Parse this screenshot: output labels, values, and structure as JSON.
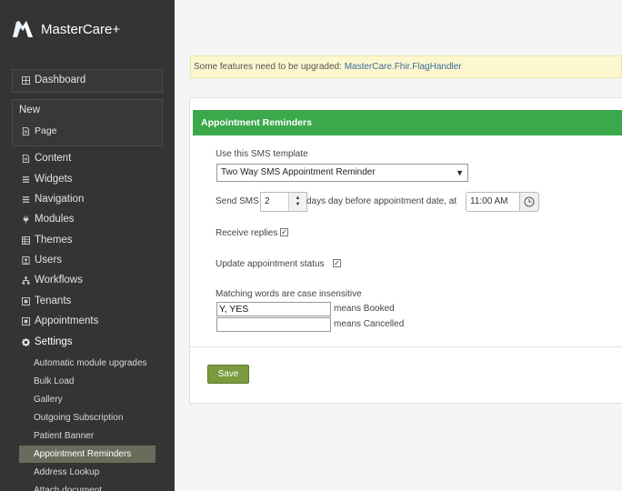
{
  "app": {
    "brand": "MasterCare+"
  },
  "sidebar": {
    "dashboard": "Dashboard",
    "new_title": "New",
    "new_page": "Page",
    "items": [
      {
        "label": "Content",
        "icon": "list-icon"
      },
      {
        "label": "Widgets",
        "icon": "list-icon"
      },
      {
        "label": "Navigation",
        "icon": "list-icon"
      },
      {
        "label": "Modules",
        "icon": "plug-icon"
      },
      {
        "label": "Themes",
        "icon": "grid-icon"
      },
      {
        "label": "Users",
        "icon": "user-icon"
      },
      {
        "label": "Workflows",
        "icon": "sitemap-icon"
      },
      {
        "label": "Tenants",
        "icon": "square-icon"
      },
      {
        "label": "Appointments",
        "icon": "square-icon"
      },
      {
        "label": "Settings",
        "icon": "gear-icon"
      }
    ],
    "settings_sub": [
      "Automatic module upgrades",
      "Bulk Load",
      "Gallery",
      "Outgoing Subscription",
      "Patient Banner",
      "Appointment Reminders",
      "Address Lookup",
      "Attach document"
    ],
    "active_sub": "Appointment Reminders"
  },
  "warning": {
    "text": "Some features need to be upgraded: ",
    "link": "MasterCare.Fhir.FlagHandler"
  },
  "panel": {
    "title": "Appointment Reminders",
    "template_label": "Use this SMS template",
    "template_value": "Two Way SMS Appointment Reminder",
    "send_sms_label": "Send SMS",
    "days_value": "2",
    "days_suffix": "days day before appointment date, at",
    "time_value": "11:00 AM",
    "receive_replies_label": "Receive replies",
    "receive_replies_checked": true,
    "update_status_label": "Update appointment status",
    "update_status_checked": true,
    "matching_label": "Matching words are case insensitive",
    "booked_value": "Y, YES",
    "booked_suffix": "means Booked",
    "cancelled_value": "",
    "cancelled_suffix": "means Cancelled",
    "save_label": "Save"
  },
  "colors": {
    "sidebar_bg": "#343434",
    "header_green": "#3aa84b",
    "save_green": "#7a9a3d",
    "warning_bg": "#fcf7cf",
    "active_item_bg": "#6b6b5c"
  }
}
